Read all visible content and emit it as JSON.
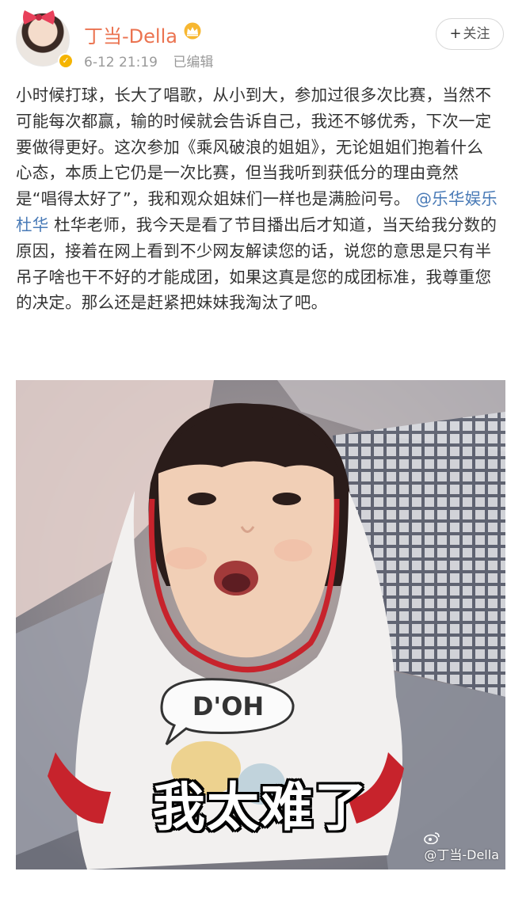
{
  "author": {
    "name": "丁当-Della",
    "date": "6-12 21:19",
    "edited_label": "已编辑",
    "verified": true
  },
  "follow_button": {
    "label": "关注",
    "plus": "+"
  },
  "post": {
    "text_before": "小时候打球，长大了唱歌，从小到大，参加过很多次比赛，当然不可能每次都赢，输的时候就会告诉自己，我还不够优秀，下次一定要做得更好。这次参加《乘风破浪的姐姐》，无论姐姐们抱着什么心态，本质上它仍是一次比赛，但当我听到获低分的理由竟然是“唱得太好了”，我和观众姐妹们一样也是满脸问号。 ",
    "mention": "@乐华娱乐杜华",
    "text_after": " 杜华老师，我今天是看了节目播出后才知道，当天给我分数的原因，接着在网上看到不少网友解读您的话，说您的意思是只有半吊子啥也干不好的才能成团，如果这真是您的成团标准，我尊重您的决定。那么还是赶紧把妹妹我淘汰了吧。"
  },
  "image": {
    "caption": "我太难了",
    "shirt_text": "D'OH",
    "watermark": "@丁当-Della"
  },
  "colors": {
    "username": "#eb7350",
    "mention": "#4a7bb7",
    "meta": "#999999",
    "badge": "#f5b400"
  },
  "icons": [
    "crown-icon",
    "verified-icon",
    "bow-icon",
    "weibo-icon"
  ]
}
